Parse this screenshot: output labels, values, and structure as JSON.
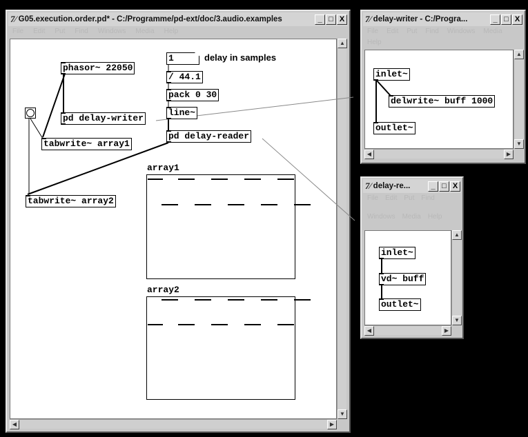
{
  "main_window": {
    "title": "G05.execution.order.pd* - C:/Programme/pd-ext/doc/3.audio.examples",
    "menu": [
      "File",
      "Edit",
      "Put",
      "Find",
      "Windows",
      "Media",
      "Help"
    ],
    "objects": {
      "phasor": "phasor~ 22050",
      "delay_writer": "pd delay-writer",
      "tabwrite1": "tabwrite~ array1",
      "tabwrite2": "tabwrite~ array2",
      "number": "1",
      "number_comment": "delay in samples",
      "divide": "/ 44.1",
      "pack": "pack 0 30",
      "line": "line~",
      "delay_reader": "pd delay-reader"
    },
    "arrays": {
      "array1": "array1",
      "array2": "array2"
    }
  },
  "writer_window": {
    "title": "delay-writer - C:/Progra...",
    "menu": [
      "File",
      "Edit",
      "Put",
      "Find",
      "Windows",
      "Media",
      "Help"
    ],
    "objects": {
      "inlet": "inlet~",
      "delwrite": "delwrite~ buff 1000",
      "outlet": "outlet~"
    }
  },
  "reader_window": {
    "title": "delay-re...",
    "menu": [
      "File",
      "Edit",
      "Put",
      "Find",
      "Windows",
      "Media",
      "Help"
    ],
    "objects": {
      "inlet": "inlet~",
      "vd": "vd~ buff",
      "outlet": "outlet~"
    }
  },
  "window_buttons": {
    "minimize": "_",
    "maximize": "□",
    "close": "X"
  },
  "icons": [
    "pd-logo-icon",
    "minimize-icon",
    "maximize-icon",
    "close-icon",
    "scroll-up-icon",
    "scroll-down-icon",
    "scroll-left-icon",
    "scroll-right-icon"
  ]
}
